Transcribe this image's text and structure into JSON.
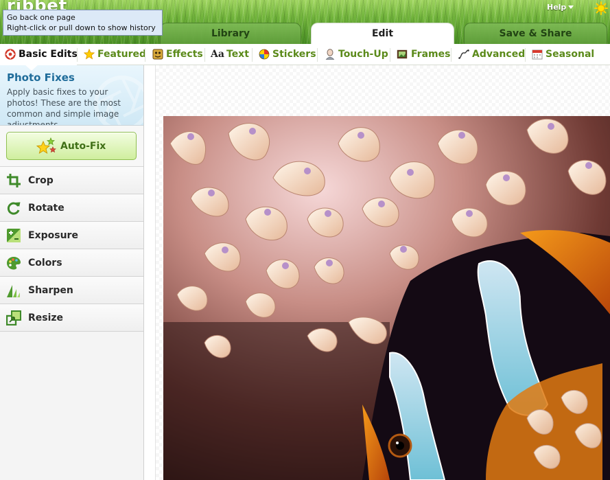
{
  "app": {
    "logo": "ribbet"
  },
  "header": {
    "help_label": "Help",
    "tabs": [
      {
        "label": "Library",
        "active": false
      },
      {
        "label": "Edit",
        "active": true
      },
      {
        "label": "Save & Share",
        "active": false
      }
    ]
  },
  "tooltip": {
    "line1": "Go back one page",
    "line2": "Right-click or pull down to show history"
  },
  "subtabs": [
    {
      "label": "Basic Edits",
      "icon": "basic-edits-icon",
      "active": true
    },
    {
      "label": "Featured",
      "icon": "star-icon",
      "active": false
    },
    {
      "label": "Effects",
      "icon": "effects-icon",
      "active": false
    },
    {
      "label": "Text",
      "icon": "text-icon",
      "icon_text": "Aa",
      "active": false
    },
    {
      "label": "Stickers",
      "icon": "stickers-ball-icon",
      "active": false
    },
    {
      "label": "Touch-Up",
      "icon": "touch-up-icon",
      "active": false
    },
    {
      "label": "Frames",
      "icon": "frames-icon",
      "active": false
    },
    {
      "label": "Advanced",
      "icon": "curve-icon",
      "active": false
    },
    {
      "label": "Seasonal",
      "icon": "calendar-icon",
      "active": false
    }
  ],
  "sidebar": {
    "section": {
      "title": "Photo Fixes",
      "description": "Apply basic fixes to your photos! These are the most common and simple image adjustments."
    },
    "autofix_label": "Auto-Fix",
    "tools": [
      {
        "label": "Crop",
        "icon": "crop-icon"
      },
      {
        "label": "Rotate",
        "icon": "rotate-icon"
      },
      {
        "label": "Exposure",
        "icon": "exposure-icon"
      },
      {
        "label": "Colors",
        "icon": "palette-icon"
      },
      {
        "label": "Sharpen",
        "icon": "sharpen-icon"
      },
      {
        "label": "Resize",
        "icon": "resize-icon"
      }
    ]
  },
  "colors": {
    "subtab_text": "#5b8a1a",
    "section_title": "#1f6c9a",
    "autofix_text": "#3f6f16",
    "tab_active_bg": "#ffffff"
  }
}
